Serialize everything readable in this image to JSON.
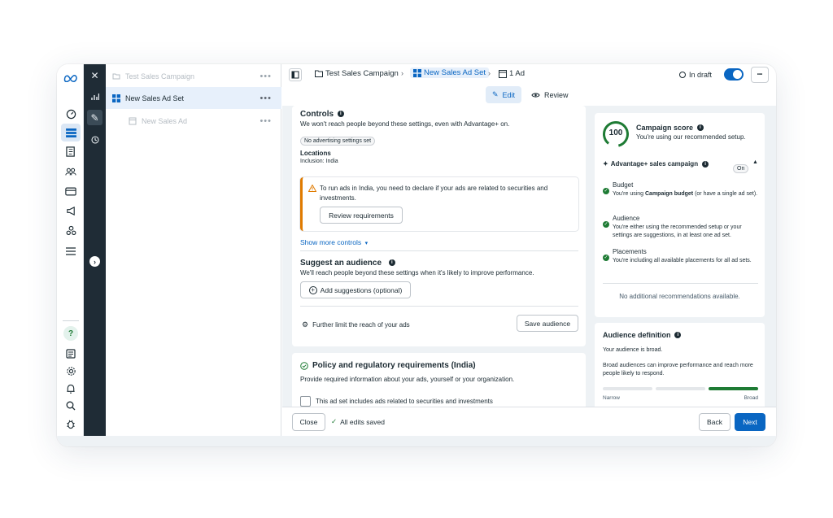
{
  "brand": {
    "logo_icon": "meta-logo-icon",
    "accent": "#0a66c2"
  },
  "tree": {
    "campaign": "Test Sales Campaign",
    "adset": "New Sales Ad Set",
    "ad": "New Sales Ad"
  },
  "topbar": {
    "crumb_campaign": "Test Sales Campaign",
    "crumb_adset": "New Sales Ad Set",
    "crumb_ad": "1 Ad",
    "status": "In draft",
    "more": "•••"
  },
  "tabs": {
    "edit": "Edit",
    "review": "Review"
  },
  "controls": {
    "title": "Controls",
    "desc": "We won't reach people beyond these settings, even with Advantage+ on.",
    "chip": "No advertising settings set",
    "locations_label": "Locations",
    "locations_value": "Inclusion: India",
    "warning": "To run ads in India, you need to declare if your ads are related to securities and investments.",
    "review_btn": "Review requirements",
    "show_more": "Show more controls"
  },
  "suggest": {
    "title": "Suggest an audience",
    "desc": "We'll reach people beyond these settings when it's likely to improve performance.",
    "add_btn": "Add suggestions (optional)",
    "further": "Further limit the reach of your ads",
    "save_btn": "Save audience"
  },
  "policy": {
    "title": "Policy and regulatory requirements (India)",
    "desc": "Provide required information about your ads, yourself or your organization.",
    "checkbox_label": "This ad set includes ads related to securities and investments"
  },
  "score": {
    "value": "100",
    "title": "Campaign score",
    "subtitle": "You're using our recommended setup.",
    "advantage": "Advantage+ sales campaign",
    "advantage_state": "On",
    "items": [
      {
        "title": "Budget",
        "desc_pre": "You're using ",
        "desc_bold": "Campaign budget",
        "desc_post": " (or have a single ad set)."
      },
      {
        "title": "Audience",
        "desc_pre": "You're either using the recommended setup or your settings are suggestions, in at least one ad set.",
        "desc_bold": "",
        "desc_post": ""
      },
      {
        "title": "Placements",
        "desc_pre": "You're including all available placements for all ad sets.",
        "desc_bold": "",
        "desc_post": ""
      }
    ],
    "no_recs": "No additional recommendations available."
  },
  "audience_def": {
    "title": "Audience definition",
    "broad": "Your audience is broad.",
    "desc": "Broad audiences can improve performance and reach more people likely to respond.",
    "narrow": "Narrow",
    "broad_label": "Broad"
  },
  "footer": {
    "close": "Close",
    "saved": "All edits saved",
    "back": "Back",
    "next": "Next"
  }
}
